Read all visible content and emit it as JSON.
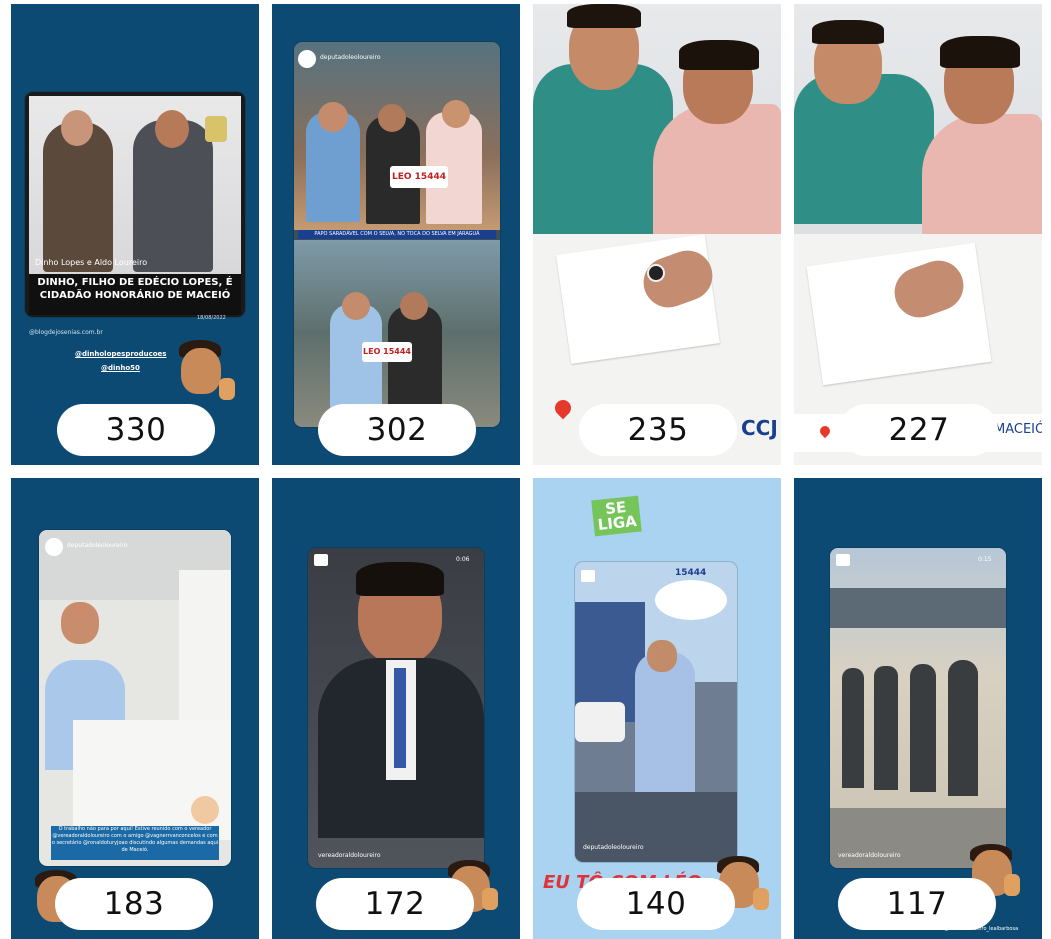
{
  "cards": [
    {
      "id": "story-1",
      "count": "330",
      "headline_top": "Dinho Lopes e Aldo Loureiro",
      "headline_main": "DINHO, FILHO DE EDÉCIO LOPES, É CIDADÃO HONORÁRIO DE MACEIÓ",
      "date": "18/08/2022",
      "source": "@blogdejosenias.com.br",
      "mention_1": "@dinholopesproducoes",
      "mention_2": "@dinho50"
    },
    {
      "id": "story-2",
      "count": "302",
      "account": "deputadoleoloureiro",
      "banner": "PAPO SARADÁVEL COM O SELVA, NO TOCA DO SELVA EM JARAGUÁ",
      "plate_1": "LEO 15444",
      "plate_2": "LEO 15444"
    },
    {
      "id": "story-3",
      "count": "235",
      "location_suffix": "CCJ"
    },
    {
      "id": "story-4",
      "count": "227",
      "location_suffix": "MACEIÓ"
    },
    {
      "id": "story-5",
      "count": "183",
      "account": "deputadoleoloureiro",
      "caption": "O trabalho não para por aqui! Estive reunido com o vereador @vereadoraldoloureiro com o amigo @vagnerrvanconcelos e com o secretário @ronaldoturyjoao discutindo algumas demandas aqui de Maceió."
    },
    {
      "id": "story-6",
      "count": "172",
      "duration": "0:06",
      "account": "vereadoraldoloureiro"
    },
    {
      "id": "story-7",
      "count": "140",
      "se_liga_1": "SE",
      "se_liga_2": "LIGA",
      "number": "15444",
      "account": "deputadoleoloureiro",
      "bottom_text": "EU TÔ COM LÉO"
    },
    {
      "id": "story-8",
      "count": "117",
      "duration": "0:15",
      "account": "vereadoraldoloureiro",
      "tag": "@cristianoribeiro_lealbarbosa"
    }
  ],
  "colors": {
    "navy": "#0d4a73",
    "light_blue": "#a9d3f0",
    "pill": "#ffffff"
  }
}
